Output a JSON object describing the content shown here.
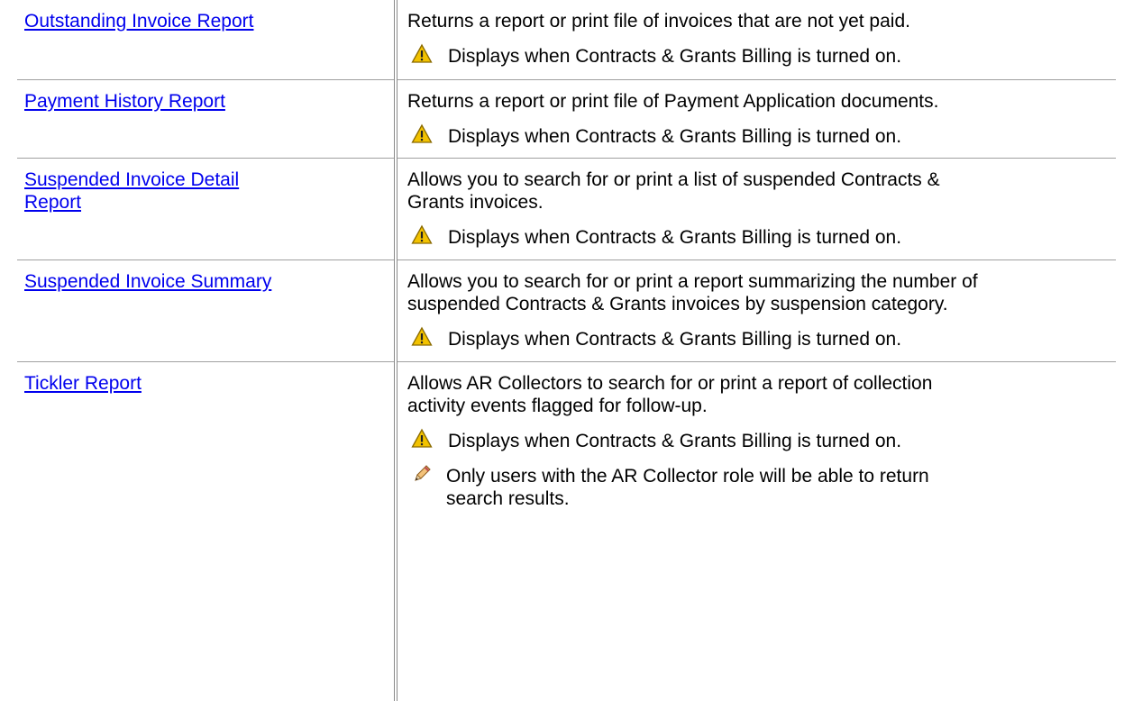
{
  "rows": [
    {
      "link": "Outstanding Invoice Report",
      "description": "Returns a report or print file of invoices that are not yet paid.",
      "warning": "Displays when Contracts & Grants Billing is turned on."
    },
    {
      "link": "Payment History Report",
      "description": "Returns a report or print file of Payment Application documents.",
      "warning": "Displays when Contracts & Grants Billing is turned on."
    },
    {
      "link_line1": "Suspended Invoice Detail",
      "link_line2": "Report",
      "description_line1": "Allows you to search for or print a list of suspended Contracts &",
      "description_line2": "Grants invoices.",
      "warning": "Displays when Contracts & Grants Billing is turned on."
    },
    {
      "link": "Suspended Invoice Summary",
      "description_line1": "Allows you to search for or print a report summarizing the number of",
      "description_line2": "suspended Contracts & Grants invoices by suspension category.",
      "warning": "Displays when Contracts & Grants Billing is turned on."
    },
    {
      "link": "Tickler Report",
      "description_line1": "Allows AR Collectors to search for or print a report of collection",
      "description_line2": "activity events flagged for follow-up.",
      "warning": "Displays when Contracts & Grants Billing is turned on.",
      "note_line1": "Only users with the AR Collector role will be able to return",
      "note_line2": "search results."
    }
  ],
  "icons": {
    "warning": "warning-icon",
    "note": "pencil-icon"
  },
  "colors": {
    "link": "#0000ee",
    "warning_fill": "#f2c200"
  }
}
